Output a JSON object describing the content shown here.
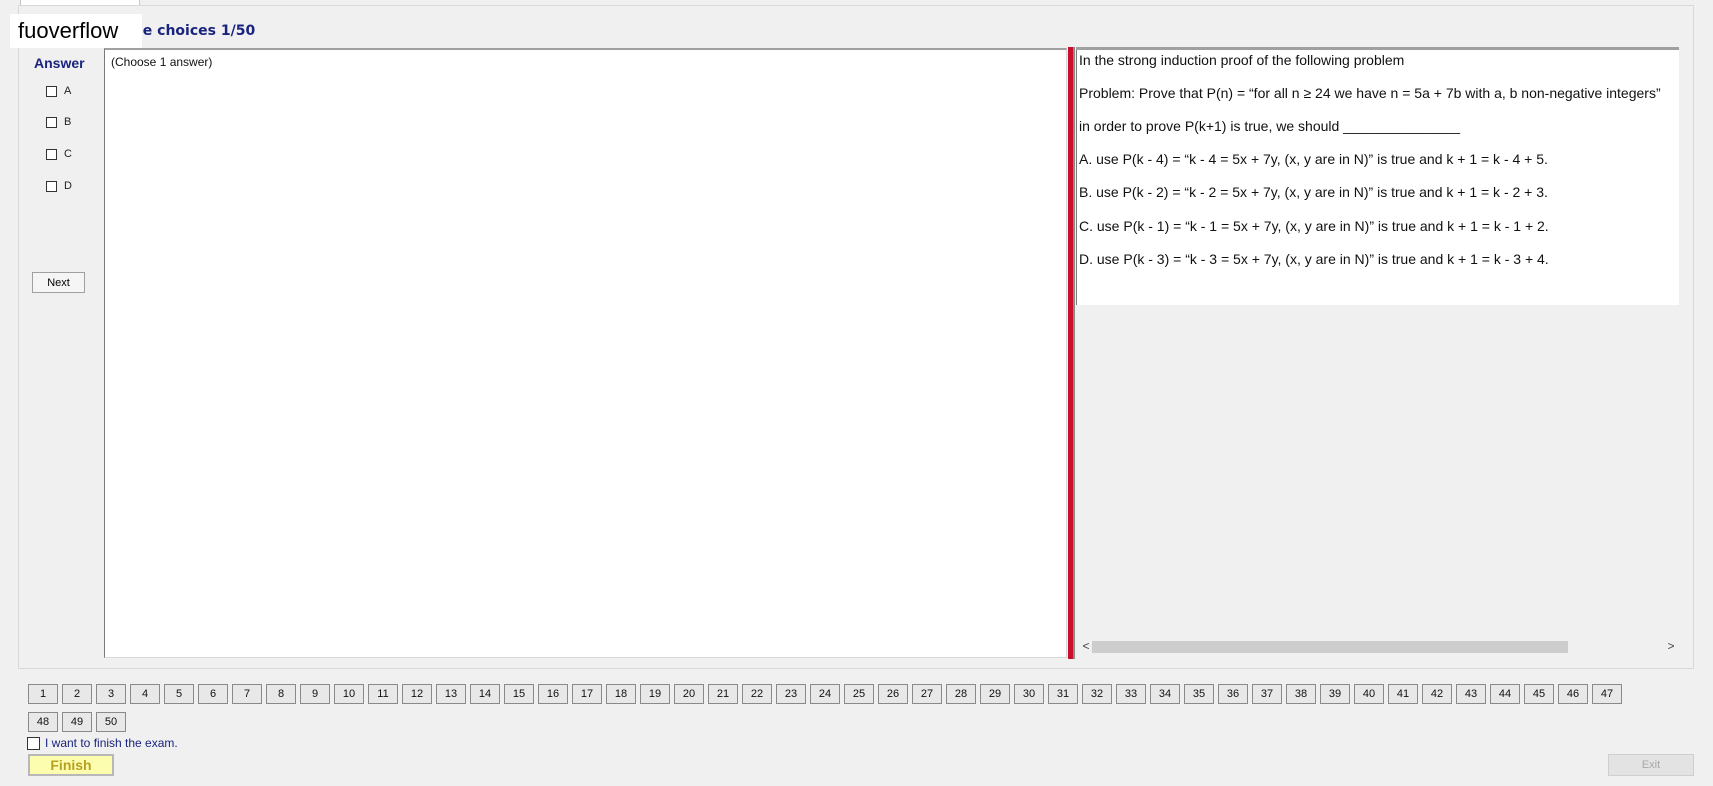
{
  "watermark": "fuoverflow",
  "section_title": "le choices 1/50",
  "answer_panel": {
    "label": "Answer",
    "options": [
      "A",
      "B",
      "C",
      "D"
    ],
    "next_label": "Next"
  },
  "answer_area": {
    "hint": "(Choose 1 answer)"
  },
  "question": {
    "lines": [
      "In the strong induction proof of the following problem",
      "Problem: Prove that P(n) = “for all n ≥ 24 we have n = 5a + 7b with a, b non-negative integers”",
      "in order to prove P(k+1) is true, we should _______________",
      "A.  use P(k - 4) = “k - 4 = 5x + 7y, (x, y  are in N)” is true and k + 1 = k - 4 + 5.",
      "B.  use P(k - 2) = “k - 2 = 5x + 7y, (x, y are in N)” is true and k + 1 = k - 2 + 3.",
      "C.  use P(k - 1) = “k - 1 = 5x + 7y, (x, y are in N)” is true and k + 1 = k - 1 + 2.",
      "D.  use P(k - 3) =  “k - 3 = 5x + 7y, (x, y are in N)” is true and k + 1 = k - 3 + 4."
    ]
  },
  "scrollbar": {
    "left_arrow": "<",
    "right_arrow": ">"
  },
  "question_numbers": [
    "1",
    "2",
    "3",
    "4",
    "5",
    "6",
    "7",
    "8",
    "9",
    "10",
    "11",
    "12",
    "13",
    "14",
    "15",
    "16",
    "17",
    "18",
    "19",
    "20",
    "21",
    "22",
    "23",
    "24",
    "25",
    "26",
    "27",
    "28",
    "29",
    "30",
    "31",
    "32",
    "33",
    "34",
    "35",
    "36",
    "37",
    "38",
    "39",
    "40",
    "41",
    "42",
    "43",
    "44",
    "45",
    "46",
    "47",
    "48",
    "49",
    "50"
  ],
  "finish_checkbox_label": "I want to finish the exam.",
  "finish_label": "Finish",
  "exit_label": "Exit",
  "colors": {
    "title_blue": "#1a237e",
    "divider_red": "#c8102e",
    "finish_yellow": "#fdfdb0"
  }
}
